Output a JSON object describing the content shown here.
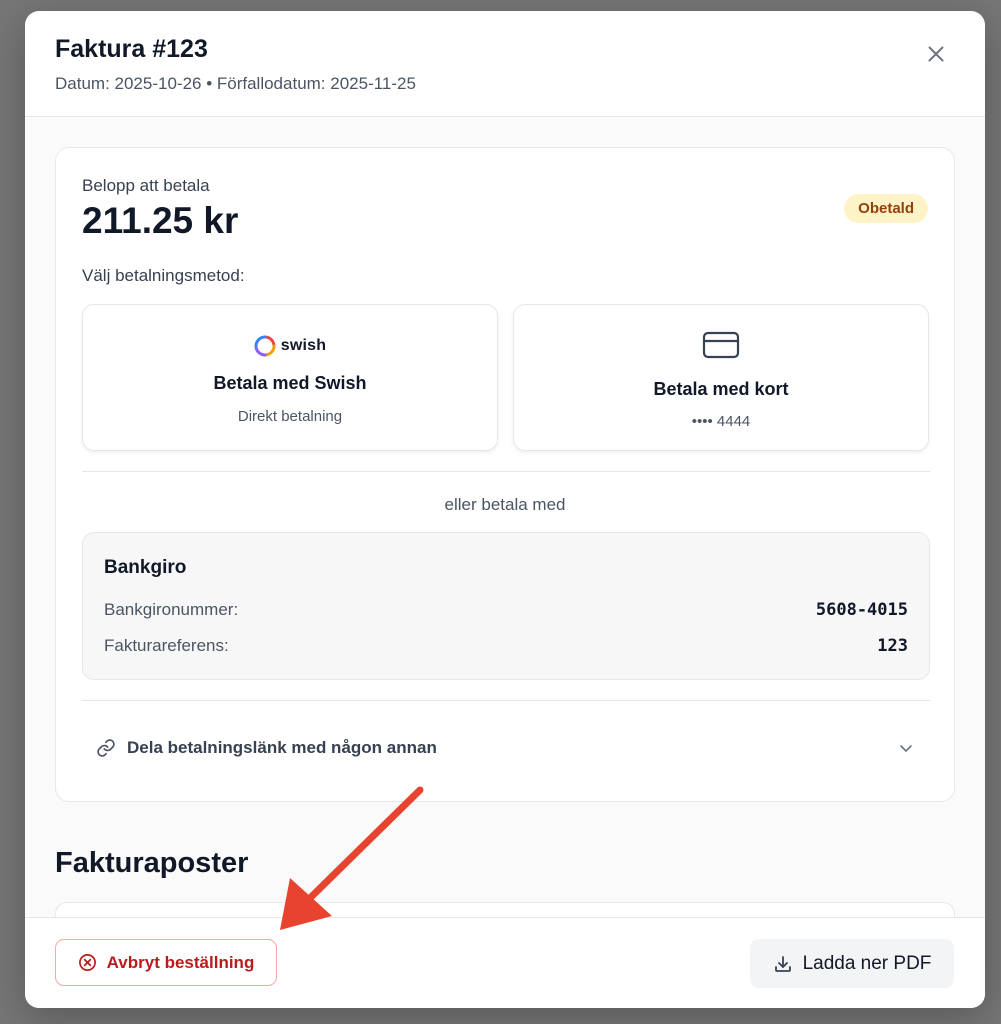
{
  "invoice": {
    "title": "Faktura #123",
    "subtitle": "Datum: 2025-10-26 • Förfallodatum: 2025-11-25"
  },
  "payment": {
    "amount_label": "Belopp att betala",
    "amount": "211.25 kr",
    "status": "Obetald",
    "method_prompt": "Välj betalningsmetod:",
    "swish": {
      "logo_text": "swish",
      "title": "Betala med Swish",
      "subtitle": "Direkt betalning"
    },
    "card": {
      "title": "Betala med kort",
      "subtitle": "•••• 4444"
    },
    "or_label": "eller betala med",
    "bankgiro": {
      "title": "Bankgiro",
      "rows": [
        {
          "label": "Bankgironummer:",
          "value": "5608-4015"
        },
        {
          "label": "Fakturareferens:",
          "value": "123"
        }
      ]
    },
    "share_label": "Dela betalningslänk med någon annan"
  },
  "items_section": {
    "title": "Fakturaposter"
  },
  "footer": {
    "cancel_label": "Avbryt beställning",
    "pdf_label": "Ladda ner PDF"
  },
  "colors": {
    "status_bg": "#fef3c7",
    "status_text": "#92400e",
    "cancel": "#b91c1c",
    "annotation_arrow": "#e8432e"
  },
  "icons": [
    "close-icon",
    "swish-logo-icon",
    "credit-card-icon",
    "link-icon",
    "chevron-down-icon",
    "cancel-circle-icon",
    "download-icon",
    "annotation-arrow"
  ]
}
